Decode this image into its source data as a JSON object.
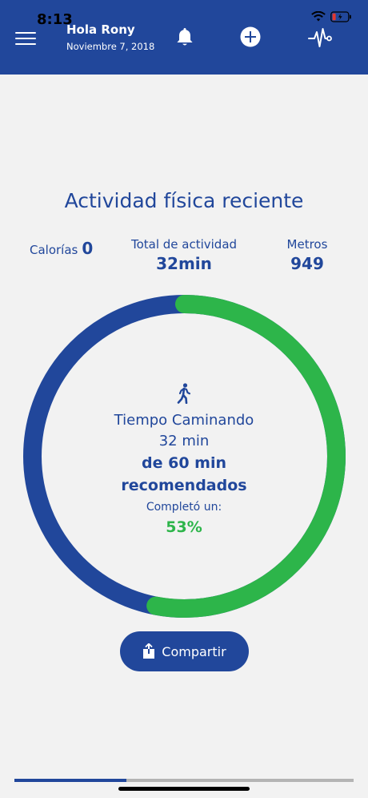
{
  "status_bar": {
    "time": "8:13"
  },
  "header": {
    "greeting": "Hola Rony",
    "date": "Noviembre 7, 2018",
    "icons": [
      "menu-icon",
      "bell-icon",
      "plus-icon",
      "pulse-icon"
    ],
    "background_color": "#21479b"
  },
  "title": "Actividad física reciente",
  "stats": {
    "calorias_label": "Calorías",
    "calorias_value": "0",
    "total_label": "Total de actividad",
    "total_value": "32min",
    "metros_label": "Metros",
    "metros_value": "949"
  },
  "ring": {
    "progress": 0.53,
    "line1": "Tiempo Caminando",
    "line2": "32 min",
    "line3": "de 60 min",
    "line4": "recomendados",
    "line5": "Completó un:",
    "percent": "53%",
    "colors": {
      "progress": "#2db54a",
      "remaining": "#21479b"
    }
  },
  "share_button": {
    "label": "Compartir"
  },
  "bottom_progress": {
    "fraction": 0.33
  }
}
